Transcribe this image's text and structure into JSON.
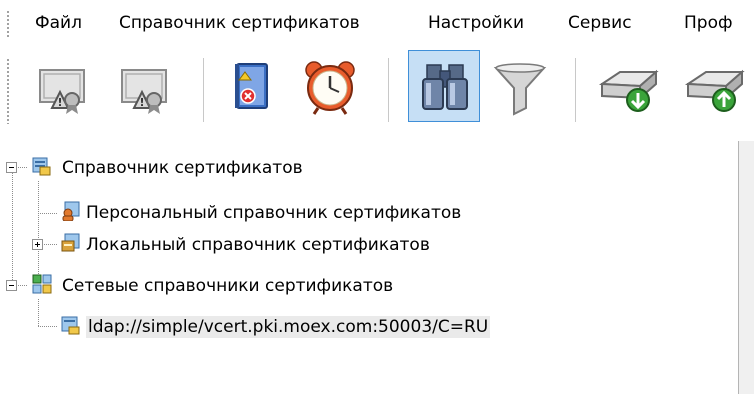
{
  "menu": {
    "items": [
      "Файл",
      "Справочник сертификатов",
      "Настройки",
      "Сервис",
      "Проф"
    ]
  },
  "toolbar": {
    "buttons": [
      {
        "icon": "certificate-warning-icon",
        "active": false
      },
      {
        "icon": "certificate-warning-icon",
        "active": false
      },
      {
        "icon": "crl-book-icon",
        "active": false
      },
      {
        "icon": "alarm-clock-icon",
        "active": false
      },
      {
        "icon": "binoculars-icon",
        "active": true
      },
      {
        "icon": "filter-funnel-icon",
        "active": false
      },
      {
        "icon": "disk-import-icon",
        "active": false
      },
      {
        "icon": "disk-export-icon",
        "active": false
      }
    ]
  },
  "tree": {
    "root": {
      "label": "Справочник сертификатов",
      "expanded": true
    },
    "personal": {
      "label": "Персональный справочник сертификатов"
    },
    "local": {
      "label": "Локальный справочник сертификатов",
      "expanded": false
    },
    "network": {
      "label": "Сетевые справочники сертификатов",
      "expanded": true
    },
    "ldap": {
      "label": "ldap://simple/vcert.pki.moex.com:50003/C=RU",
      "selected": true
    }
  },
  "colors": {
    "selection_highlight": "#eaeaea",
    "active_button_bg": "#c6dff5",
    "active_button_border": "#3f8fd8"
  }
}
